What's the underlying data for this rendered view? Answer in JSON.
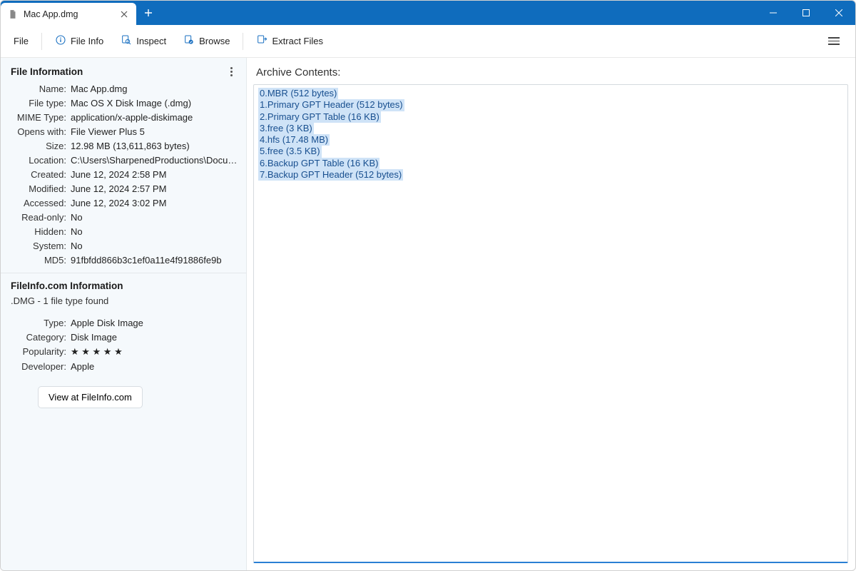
{
  "tab": {
    "title": "Mac App.dmg"
  },
  "toolbar": {
    "file": "File",
    "fileinfo": "File Info",
    "inspect": "Inspect",
    "browse": "Browse",
    "extract": "Extract Files"
  },
  "sidebar": {
    "fileinfo_header": "File Information",
    "rows": {
      "name_l": "Name:",
      "name_v": "Mac App.dmg",
      "filetype_l": "File type:",
      "filetype_v": "Mac OS X Disk Image (.dmg)",
      "mime_l": "MIME Type:",
      "mime_v": "application/x-apple-diskimage",
      "opens_l": "Opens with:",
      "opens_v": "File Viewer Plus 5",
      "size_l": "Size:",
      "size_v": "12.98 MB (13,611,863 bytes)",
      "loc_l": "Location:",
      "loc_v": "C:\\Users\\SharpenedProductions\\Documents\\...",
      "created_l": "Created:",
      "created_v": "June 12, 2024 2:58 PM",
      "modified_l": "Modified:",
      "modified_v": "June 12, 2024 2:57 PM",
      "accessed_l": "Accessed:",
      "accessed_v": "June 12, 2024 3:02 PM",
      "readonly_l": "Read-only:",
      "readonly_v": "No",
      "hidden_l": "Hidden:",
      "hidden_v": "No",
      "system_l": "System:",
      "system_v": "No",
      "md5_l": "MD5:",
      "md5_v": "91fbfdd866b3c1ef0a11e4f91886fe9b"
    },
    "fileinfocom_header": "FileInfo.com Information",
    "fileinfocom_sub": ".DMG - 1 file type found",
    "fileinfocom_rows": {
      "type_l": "Type:",
      "type_v": "Apple Disk Image",
      "cat_l": "Category:",
      "cat_v": "Disk Image",
      "pop_l": "Popularity:",
      "pop_v": "★ ★ ★ ★ ★",
      "dev_l": "Developer:",
      "dev_v": "Apple"
    },
    "view_btn": "View at FileInfo.com"
  },
  "main": {
    "title": "Archive Contents:",
    "lines": [
      "0.MBR (512 bytes)",
      "1.Primary GPT Header (512 bytes)",
      "2.Primary GPT Table (16 KB)",
      "3.free (3 KB)",
      "4.hfs (17.48 MB)",
      "5.free (3.5 KB)",
      "6.Backup GPT Table (16 KB)",
      "7.Backup GPT Header (512 bytes)"
    ]
  }
}
